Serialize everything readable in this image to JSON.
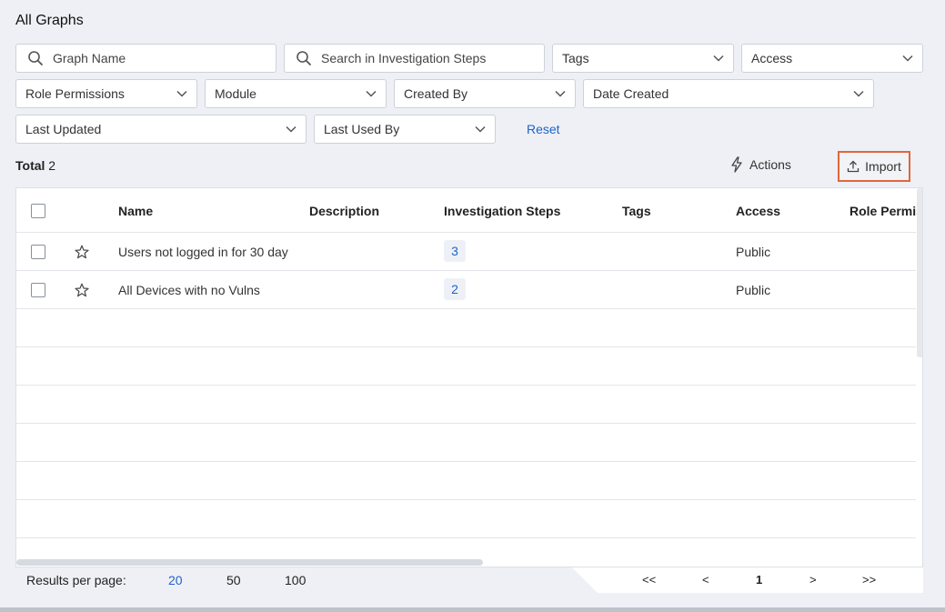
{
  "page": {
    "title": "All Graphs"
  },
  "filters": {
    "graph_name_placeholder": "Graph Name",
    "investigation_search_placeholder": "Search in Investigation Steps",
    "tags": "Tags",
    "access": "Access",
    "role_permissions": "Role Permissions",
    "module": "Module",
    "created_by": "Created By",
    "date_created": "Date Created",
    "last_updated": "Last Updated",
    "last_used_by": "Last Used By",
    "reset": "Reset"
  },
  "summary": {
    "total_label": "Total",
    "total_count": "2"
  },
  "toolbar": {
    "actions_label": "Actions",
    "import_label": "Import",
    "actions_icon": "lightning-icon",
    "import_icon": "upload-icon"
  },
  "table": {
    "columns": {
      "name": "Name",
      "description": "Description",
      "investigation_steps": "Investigation Steps",
      "tags": "Tags",
      "access": "Access",
      "role_permissions": "Role Permis"
    },
    "rows": [
      {
        "name": "Users not logged in for 30 day",
        "description": "",
        "steps": "3",
        "tags": "",
        "access": "Public"
      },
      {
        "name": "All Devices with no Vulns",
        "description": "",
        "steps": "2",
        "tags": "",
        "access": "Public"
      }
    ]
  },
  "pagination": {
    "results_per_page_label": "Results per page:",
    "options": [
      "20",
      "50",
      "100"
    ],
    "selected": "20",
    "first": "<<",
    "prev": "<",
    "current": "1",
    "next": ">",
    "last": ">>"
  },
  "colors": {
    "accent": "#1f63c9",
    "highlight_border": "#e2663a"
  }
}
